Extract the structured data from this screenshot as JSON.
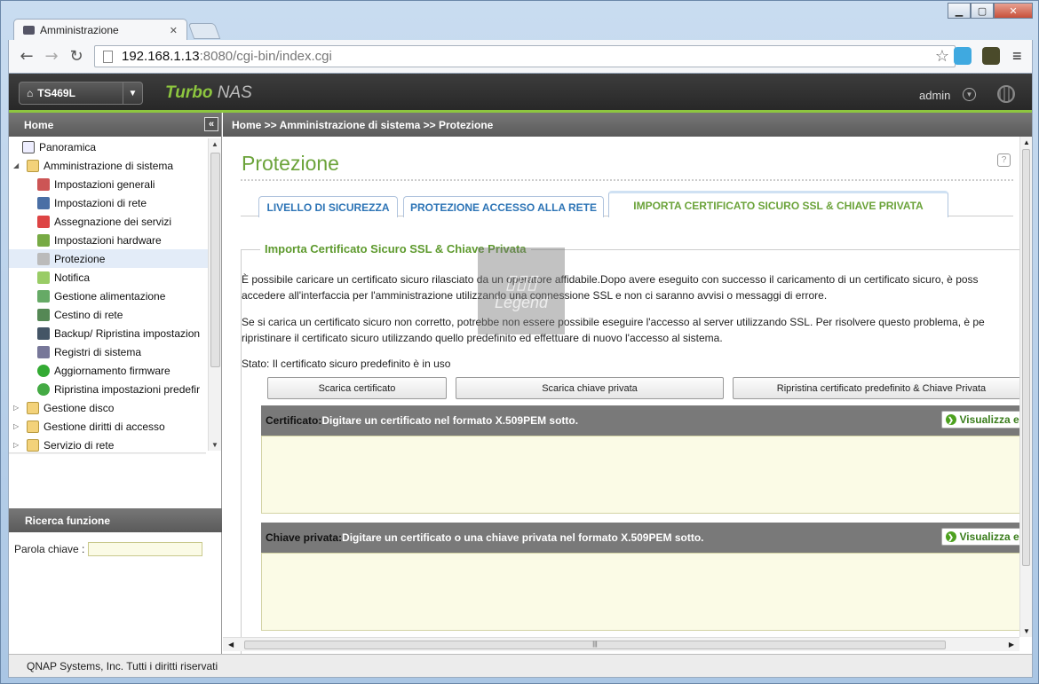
{
  "browser": {
    "tab_title": "Amministrazione",
    "url_host": "192.168.1.13",
    "url_rest": ":8080/cgi-bin/index.cgi",
    "window_controls": [
      "minimize-icon",
      "maximize-icon",
      "close-icon"
    ]
  },
  "header": {
    "model": "TS469L",
    "brand_turbo": "Turbo",
    "brand_nas": " NAS",
    "user": "admin",
    "accent_color": "#8dc63f"
  },
  "sidebar": {
    "title": "Home",
    "items": [
      {
        "label": "Panoramica",
        "level": 0,
        "icon": "overview-icon"
      },
      {
        "label": "Amministrazione di sistema",
        "level": 0,
        "expanded": true,
        "icon": "folder-open-icon"
      },
      {
        "label": "Impostazioni generali",
        "level": 1,
        "icon": "general-settings-icon"
      },
      {
        "label": "Impostazioni di rete",
        "level": 1,
        "icon": "network-icon"
      },
      {
        "label": "Assegnazione dei servizi",
        "level": 1,
        "icon": "services-icon"
      },
      {
        "label": "Impostazioni hardware",
        "level": 1,
        "icon": "hardware-icon"
      },
      {
        "label": "Protezione",
        "level": 1,
        "selected": true,
        "icon": "security-icon"
      },
      {
        "label": "Notifica",
        "level": 1,
        "icon": "notification-icon"
      },
      {
        "label": "Gestione alimentazione",
        "level": 1,
        "icon": "power-icon"
      },
      {
        "label": "Cestino di rete",
        "level": 1,
        "icon": "recycle-bin-icon"
      },
      {
        "label": "Backup/ Ripristina impostazion",
        "level": 1,
        "icon": "backup-icon"
      },
      {
        "label": "Registri di sistema",
        "level": 1,
        "icon": "logs-icon"
      },
      {
        "label": "Aggiornamento firmware",
        "level": 1,
        "icon": "firmware-icon"
      },
      {
        "label": "Ripristina impostazioni predefir",
        "level": 1,
        "icon": "restore-icon"
      },
      {
        "label": "Gestione disco",
        "level": 0,
        "icon": "folder-icon"
      },
      {
        "label": "Gestione diritti di accesso",
        "level": 0,
        "icon": "folder-icon"
      },
      {
        "label": "Servizio di rete",
        "level": 0,
        "icon": "folder-icon"
      }
    ],
    "search_title": "Ricerca funzione",
    "keyword_label": "Parola chiave :",
    "keyword_value": ""
  },
  "breadcrumb": "Home >> Amministrazione di sistema >> Protezione",
  "page": {
    "title": "Protezione",
    "tabs": [
      {
        "label": "LIVELLO DI SICUREZZA",
        "active": false
      },
      {
        "label": "PROTEZIONE ACCESSO ALLA RETE",
        "active": false
      },
      {
        "label": "IMPORTA CERTIFICATO SICURO SSL & CHIAVE PRIVATA",
        "active": true
      }
    ],
    "section_title": "Importa Certificato Sicuro SSL & Chiave Privata",
    "para1_line1": "È possibile caricare un certificato sicuro rilasciato da un operatore affidabile.Dopo avere eseguito con successo il caricamento di un certificato sicuro, è poss",
    "para1_line2": "accedere all'interfaccia per l'amministrazione utilizzando una connessione SSL e non ci saranno avvisi o messaggi di errore.",
    "para2_line1": "Se si carica un certificato sicuro non corretto, potrebbe non essere possibile eseguire l'accesso al server utilizzando SSL. Per risolvere questo problema, è pe",
    "para2_line2": "ripristinare il certificato sicuro utilizzando quello predefinito ed effettuare di nuovo l'accesso al sistema.",
    "status": "Stato: Il certificato sicuro predefinito è in uso",
    "buttons": {
      "download_cert": "Scarica certificato",
      "download_key": "Scarica chiave privata",
      "restore_default": "Ripristina certificato predefinito & Chiave Privata"
    },
    "cert": {
      "label": "Certificato:",
      "text": " Digitare un certificato nel formato X.509PEM sotto.",
      "view_button": "Visualizza ese",
      "value": ""
    },
    "key": {
      "label": "Chiave privata:",
      "text": " Digitare un certificato o una chiave privata nel formato X.509PEM sotto.",
      "view_button": "Visualizza ese",
      "value": ""
    }
  },
  "footer": "QNAP Systems, Inc. Tutti i diritti riservati"
}
